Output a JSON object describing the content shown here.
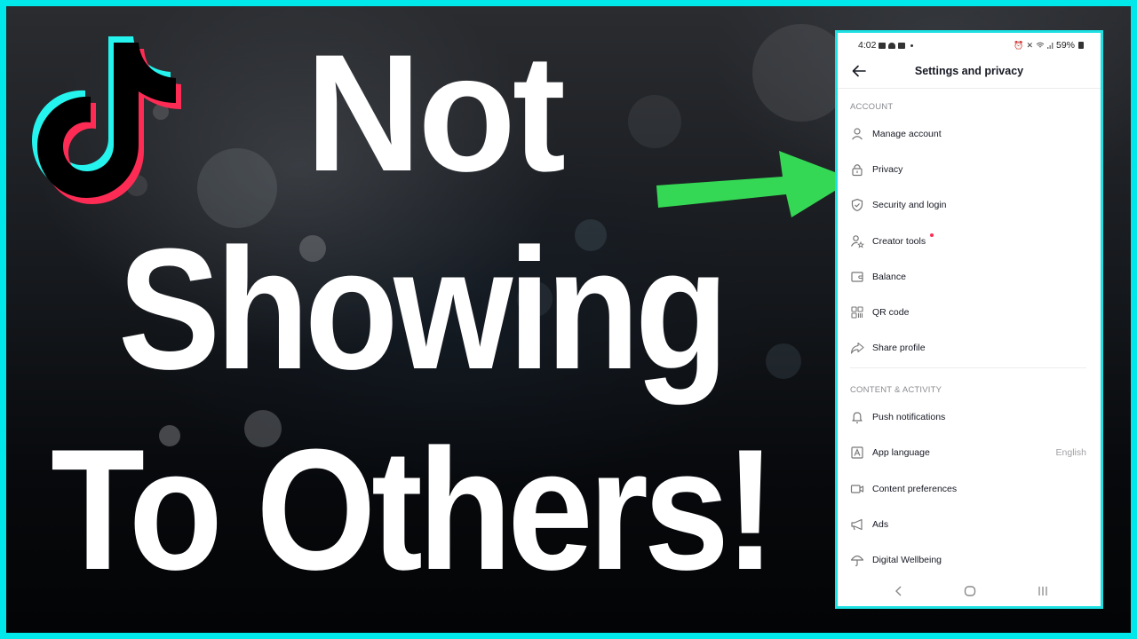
{
  "thumbnail": {
    "title_lines": [
      "Not",
      "Showing",
      "To Others!"
    ],
    "colors": {
      "frame": "#00e8ea",
      "arrow": "#35d854",
      "tiktok_cyan": "#25f4ee",
      "tiktok_red": "#fe2c55",
      "title_text": "#ffffff"
    },
    "logo": "tiktok-logo",
    "pointer": "green-arrow-right"
  },
  "phone": {
    "status_bar": {
      "time": "4:02",
      "left_icons": [
        "message-icon",
        "notification-bell-icon",
        "youtube-icon",
        "dot-icon"
      ],
      "right_icons": [
        "alarm-icon",
        "mute-icon",
        "wifi-icon",
        "signal-icon"
      ],
      "battery": "59%"
    },
    "header": {
      "back_icon": "arrow-left-icon",
      "title": "Settings and privacy"
    },
    "sections": [
      {
        "label": "ACCOUNT",
        "items": [
          {
            "label": "Manage account",
            "icon": "person-icon"
          },
          {
            "label": "Privacy",
            "icon": "lock-icon"
          },
          {
            "label": "Security and login",
            "icon": "shield-check-icon"
          },
          {
            "label": "Creator tools",
            "icon": "person-star-icon",
            "badge": "red-dot"
          },
          {
            "label": "Balance",
            "icon": "wallet-icon"
          },
          {
            "label": "QR code",
            "icon": "qr-code-icon"
          },
          {
            "label": "Share profile",
            "icon": "share-arrow-icon"
          }
        ]
      },
      {
        "label": "CONTENT & ACTIVITY",
        "items": [
          {
            "label": "Push notifications",
            "icon": "bell-icon"
          },
          {
            "label": "App language",
            "icon": "language-icon",
            "value": "English"
          },
          {
            "label": "Content preferences",
            "icon": "video-camera-icon"
          },
          {
            "label": "Ads",
            "icon": "megaphone-icon"
          },
          {
            "label": "Digital Wellbeing",
            "icon": "umbrella-icon"
          }
        ]
      }
    ],
    "nav_bar": [
      "back-nav-icon",
      "home-nav-icon",
      "recents-nav-icon"
    ]
  }
}
